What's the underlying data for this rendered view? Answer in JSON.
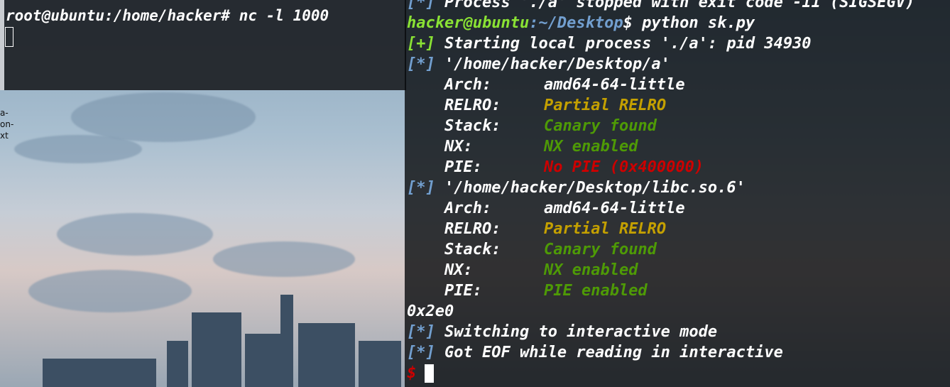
{
  "desktop": {
    "icon_fragments": [
      "a-",
      "on-",
      "xt"
    ]
  },
  "left_terminal": {
    "prompt": "root@ubuntu:/home/hacker#",
    "command": "nc -l 1000"
  },
  "right_terminal": {
    "line0": {
      "bracket": "[*]",
      "text": " Process './a' stopped with exit code -11 (SIGSEGV)"
    },
    "prompt_user": "hacker@ubuntu",
    "prompt_path": ":~/Desktop",
    "prompt_symbol": "$",
    "command": " python sk.py",
    "line2": {
      "bracket": "[+]",
      "text": " Starting local process './a': pid 34930"
    },
    "line3": {
      "bracket": "[*]",
      "text": " '/home/hacker/Desktop/a'"
    },
    "a_checksec": [
      {
        "key": "Arch:",
        "value": "amd64-64-little"
      },
      {
        "key": "RELRO:",
        "value": "Partial RELRO"
      },
      {
        "key": "Stack:",
        "value": "Canary found"
      },
      {
        "key": "NX:",
        "value": "NX enabled"
      },
      {
        "key": "PIE:",
        "value": "No PIE (0x400000)"
      }
    ],
    "line9": {
      "bracket": "[*]",
      "text": " '/home/hacker/Desktop/libc.so.6'"
    },
    "libc_checksec": [
      {
        "key": "Arch:",
        "value": "amd64-64-little"
      },
      {
        "key": "RELRO:",
        "value": "Partial RELRO"
      },
      {
        "key": "Stack:",
        "value": "Canary found"
      },
      {
        "key": "NX:",
        "value": "NX enabled"
      },
      {
        "key": "PIE:",
        "value": "PIE enabled"
      }
    ],
    "leak": "0x2e0",
    "line16": {
      "bracket": "[*]",
      "text": " Switching to interactive mode"
    },
    "line17": {
      "bracket": "[*]",
      "text": " Got EOF while reading in interactive"
    },
    "final_prompt": "$"
  },
  "colors": {
    "prompt_user": "#8ae234",
    "prompt_path": "#729fcf",
    "bracket_plus": "#8ae234",
    "bracket_star": "#729fcf",
    "relro_partial": "#c4a000",
    "enabled_green": "#4e9a06",
    "nopie_red": "#cc0000"
  }
}
